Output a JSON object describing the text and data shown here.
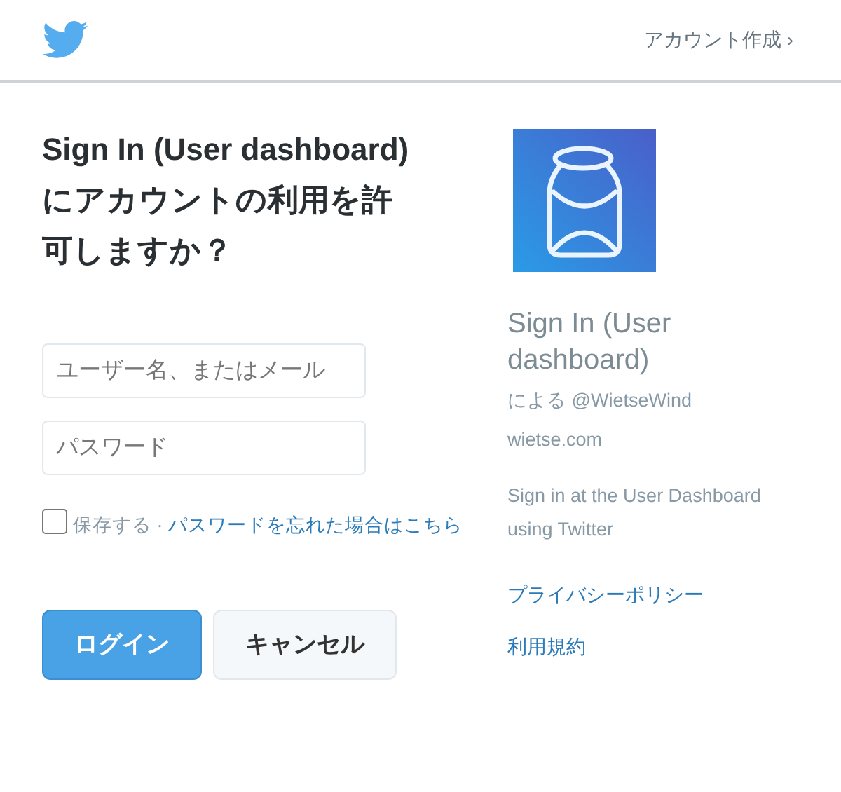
{
  "header": {
    "signup_link": "アカウント作成 ›"
  },
  "heading": "Sign In (User dashboard)にアカウントの利用を許可しますか？",
  "username_field": {
    "placeholder": "ユーザー名、またはメール"
  },
  "password_field": {
    "placeholder": "パスワード"
  },
  "remember": {
    "label": "保存する",
    "checked": false,
    "separator": "·",
    "forgot_link": "パスワードを忘れた場合はこちら"
  },
  "buttons": [
    {
      "label": "ログイン",
      "kind": "primary"
    },
    {
      "label": "キャンセル",
      "kind": "secondary"
    }
  ],
  "app": {
    "name": "Sign In (User dashboard)",
    "by": "による @WietseWind",
    "website": "wietse.com",
    "description": "Sign in at the User Dashboard using Twitter"
  },
  "links": [
    "プライバシーポリシー",
    "利用規約"
  ]
}
